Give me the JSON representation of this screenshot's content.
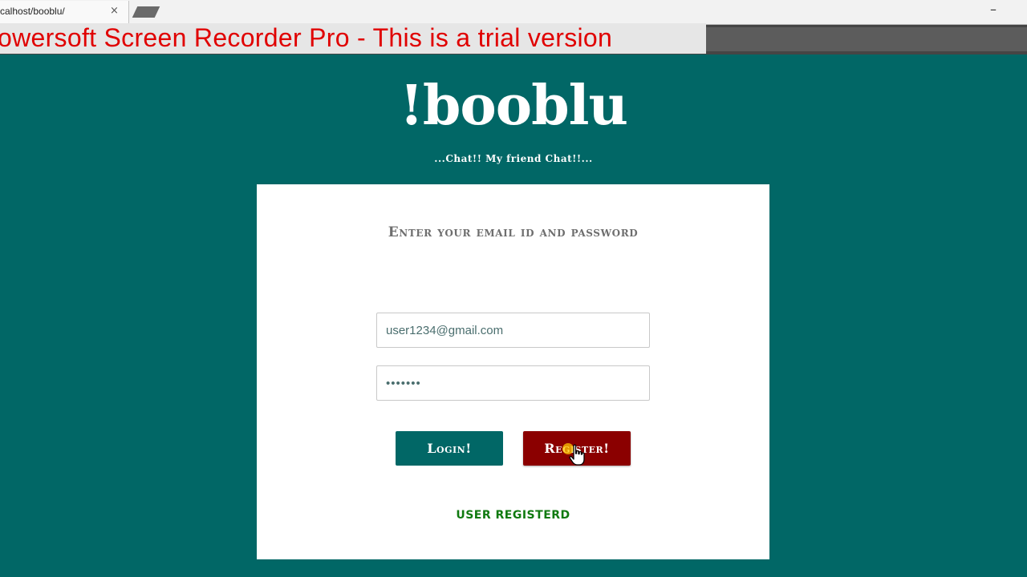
{
  "browser": {
    "tab_title": "calhost/booblu/",
    "tab_close": "×",
    "minimize": "–"
  },
  "watermark": {
    "text": "owersoft Screen Recorder Pro - This is a trial version"
  },
  "page": {
    "logo": "!booblu",
    "tagline": "...Chat!! My friend Chat!!...",
    "heading": "Enter your email id and password",
    "email_value": "user1234@gmail.com",
    "password_value": "•••••••",
    "login_label": "Login!",
    "register_label": "Register!",
    "status_message": "USER REGISTERD"
  },
  "colors": {
    "background": "#016766",
    "login_button": "#016766",
    "register_button": "#8b0000",
    "status_text": "#107a10",
    "watermark_text": "#e00000"
  },
  "icons": {
    "cursor": "hand-pointer-icon",
    "click_indicator": "click-highlight-dot"
  }
}
